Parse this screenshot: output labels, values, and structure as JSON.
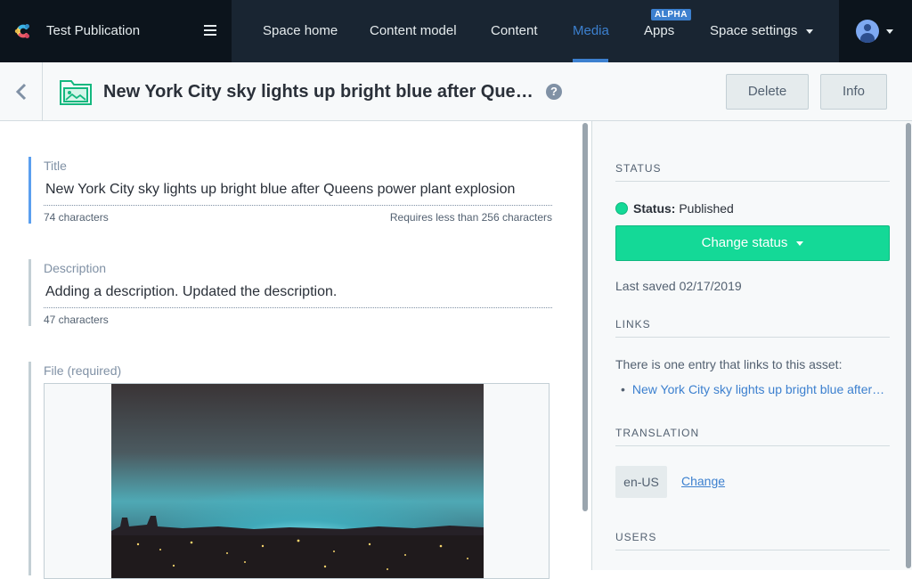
{
  "app": {
    "space_name": "Test Publication",
    "logo_icon": "contentful-logo-icon",
    "menu_icon": "hamburger-icon"
  },
  "nav": {
    "items": [
      {
        "label": "Space home",
        "active": false
      },
      {
        "label": "Content model",
        "active": false
      },
      {
        "label": "Content",
        "active": false
      },
      {
        "label": "Media",
        "active": true
      },
      {
        "label": "Apps",
        "active": false,
        "badge": "ALPHA"
      },
      {
        "label": "Space settings",
        "active": false,
        "dropdown": true
      }
    ]
  },
  "account": {
    "avatar_icon": "user-avatar-icon"
  },
  "header": {
    "title": "New York City sky lights up bright blue after Queens power plant explosion",
    "help": "?",
    "delete_label": "Delete",
    "info_label": "Info"
  },
  "fields": {
    "title": {
      "label": "Title",
      "value": "New York City sky lights up bright blue after Queens power plant explosion",
      "count": "74 characters",
      "limit": "Requires less than 256 characters"
    },
    "description": {
      "label": "Description",
      "value": "Adding a description.  Updated the description.",
      "count": "47 characters"
    },
    "file": {
      "label": "File (required)"
    }
  },
  "sidebar": {
    "status": {
      "heading": "STATUS",
      "label": "Status:",
      "value": "Published",
      "change_label": "Change status",
      "last_saved": "Last saved 02/17/2019"
    },
    "links": {
      "heading": "LINKS",
      "intro": "There is one entry that links to this asset:",
      "items": [
        "New York City sky lights up bright blue after Queens power plant explosion"
      ]
    },
    "translation": {
      "heading": "TRANSLATION",
      "locale": "en-US",
      "change_label": "Change"
    },
    "users": {
      "heading": "USERS"
    }
  },
  "colors": {
    "nav_bg": "#192532",
    "accent": "#3c80cf",
    "published": "#14d997"
  }
}
